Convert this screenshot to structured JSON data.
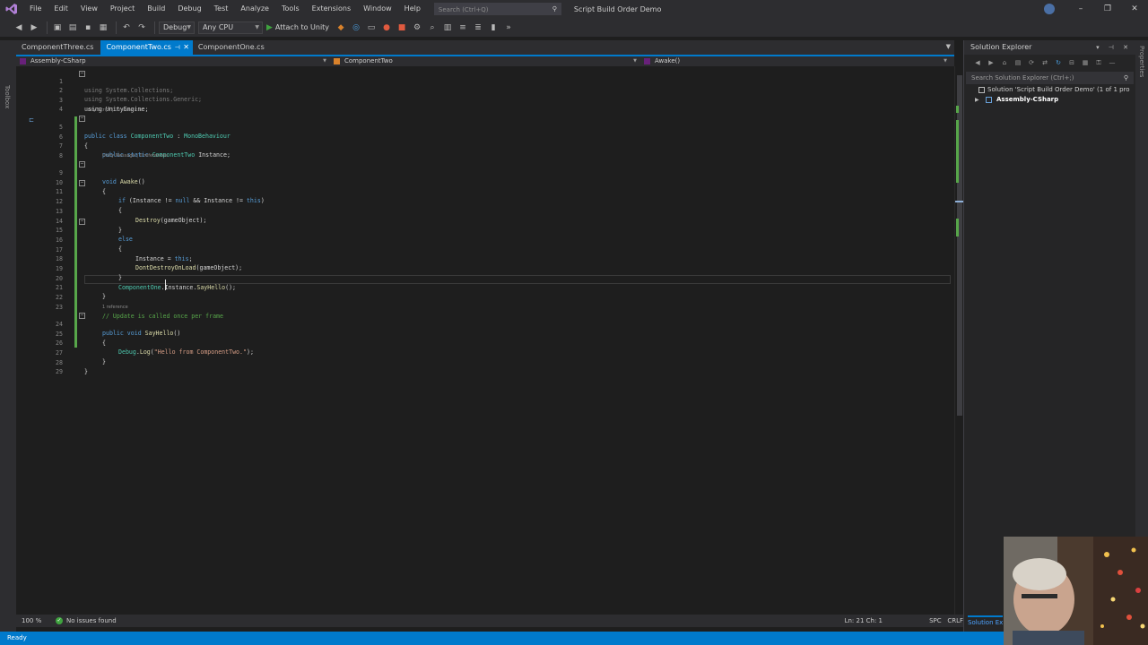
{
  "menubar": {
    "items": [
      "File",
      "Edit",
      "View",
      "Project",
      "Build",
      "Debug",
      "Test",
      "Analyze",
      "Tools",
      "Extensions",
      "Window",
      "Help"
    ],
    "search_placeholder": "Search (Ctrl+Q)",
    "window_title": "Script Build Order Demo"
  },
  "toolbar": {
    "configuration": "Debug",
    "platform": "Any CPU",
    "attach_label": "Attach to Unity"
  },
  "left_rail": {
    "label": "Toolbox"
  },
  "tabs": [
    {
      "label": "ComponentThree.cs",
      "active": false
    },
    {
      "label": "ComponentTwo.cs",
      "active": true
    },
    {
      "label": "ComponentOne.cs",
      "active": false
    }
  ],
  "navbar": {
    "project": "Assembly-CSharp",
    "class": "ComponentTwo",
    "member": "Awake()"
  },
  "code_lens": {
    "class": "Unity Script | 2 references",
    "awake": "Unity Message | 0 references",
    "sayhello": "1 reference"
  },
  "editor": {
    "lines": [
      {
        "n": "1",
        "text": "using System.Collections;"
      },
      {
        "n": "2",
        "text": "using System.Collections.Generic;"
      },
      {
        "n": "3",
        "text": "using UnityEngine;"
      },
      {
        "n": "4",
        "text": ""
      },
      {
        "n": "5",
        "text": "public class ComponentTwo : MonoBehaviour"
      },
      {
        "n": "6",
        "text": "{"
      },
      {
        "n": "7",
        "text": "public static ComponentTwo Instance;"
      },
      {
        "n": "8",
        "text": ""
      },
      {
        "n": "9",
        "text": "void Awake()"
      },
      {
        "n": "10",
        "text": "{"
      },
      {
        "n": "11",
        "text": "if (Instance != null && Instance != this)"
      },
      {
        "n": "12",
        "text": "{"
      },
      {
        "n": "13",
        "text": "Destroy(gameObject);"
      },
      {
        "n": "14",
        "text": "}"
      },
      {
        "n": "15",
        "text": "else"
      },
      {
        "n": "16",
        "text": "{"
      },
      {
        "n": "17",
        "text": "Instance = this;"
      },
      {
        "n": "18",
        "text": "DontDestroyOnLoad(gameObject);"
      },
      {
        "n": "19",
        "text": "}"
      },
      {
        "n": "20",
        "text": "ComponentOne.Instance.SayHello();"
      },
      {
        "n": "21",
        "text": "}"
      },
      {
        "n": "22",
        "text": ""
      },
      {
        "n": "23",
        "text": "// Update is called once per frame"
      },
      {
        "n": "24",
        "text": "public void SayHello()"
      },
      {
        "n": "25",
        "text": "{"
      },
      {
        "n": "26",
        "text": "Debug.Log(\"Hello from ComponentTwo.\");"
      },
      {
        "n": "27",
        "text": "}"
      },
      {
        "n": "28",
        "text": "}"
      },
      {
        "n": "29",
        "text": ""
      }
    ]
  },
  "solution_explorer": {
    "title": "Solution Explorer",
    "search_placeholder": "Search Solution Explorer (Ctrl+;)",
    "solution_node": "Solution 'Script Build Order Demo' (1 of 1 pro",
    "project_node": "Assembly-CSharp",
    "bottom_tab": "Solution Ex"
  },
  "right_rail": {
    "label": "Properties"
  },
  "edit_info": {
    "zoom": "100 %",
    "issues": "No issues found",
    "position": "Ln: 21   Ch: 1",
    "whitespace": "SPC",
    "line_ending": "CRLF"
  },
  "status": {
    "text": "Ready"
  },
  "colors": {
    "accent": "#007acc",
    "keyword": "#569cd6",
    "type": "#4ec9b0",
    "string": "#d69d85",
    "comment": "#57a64a"
  }
}
